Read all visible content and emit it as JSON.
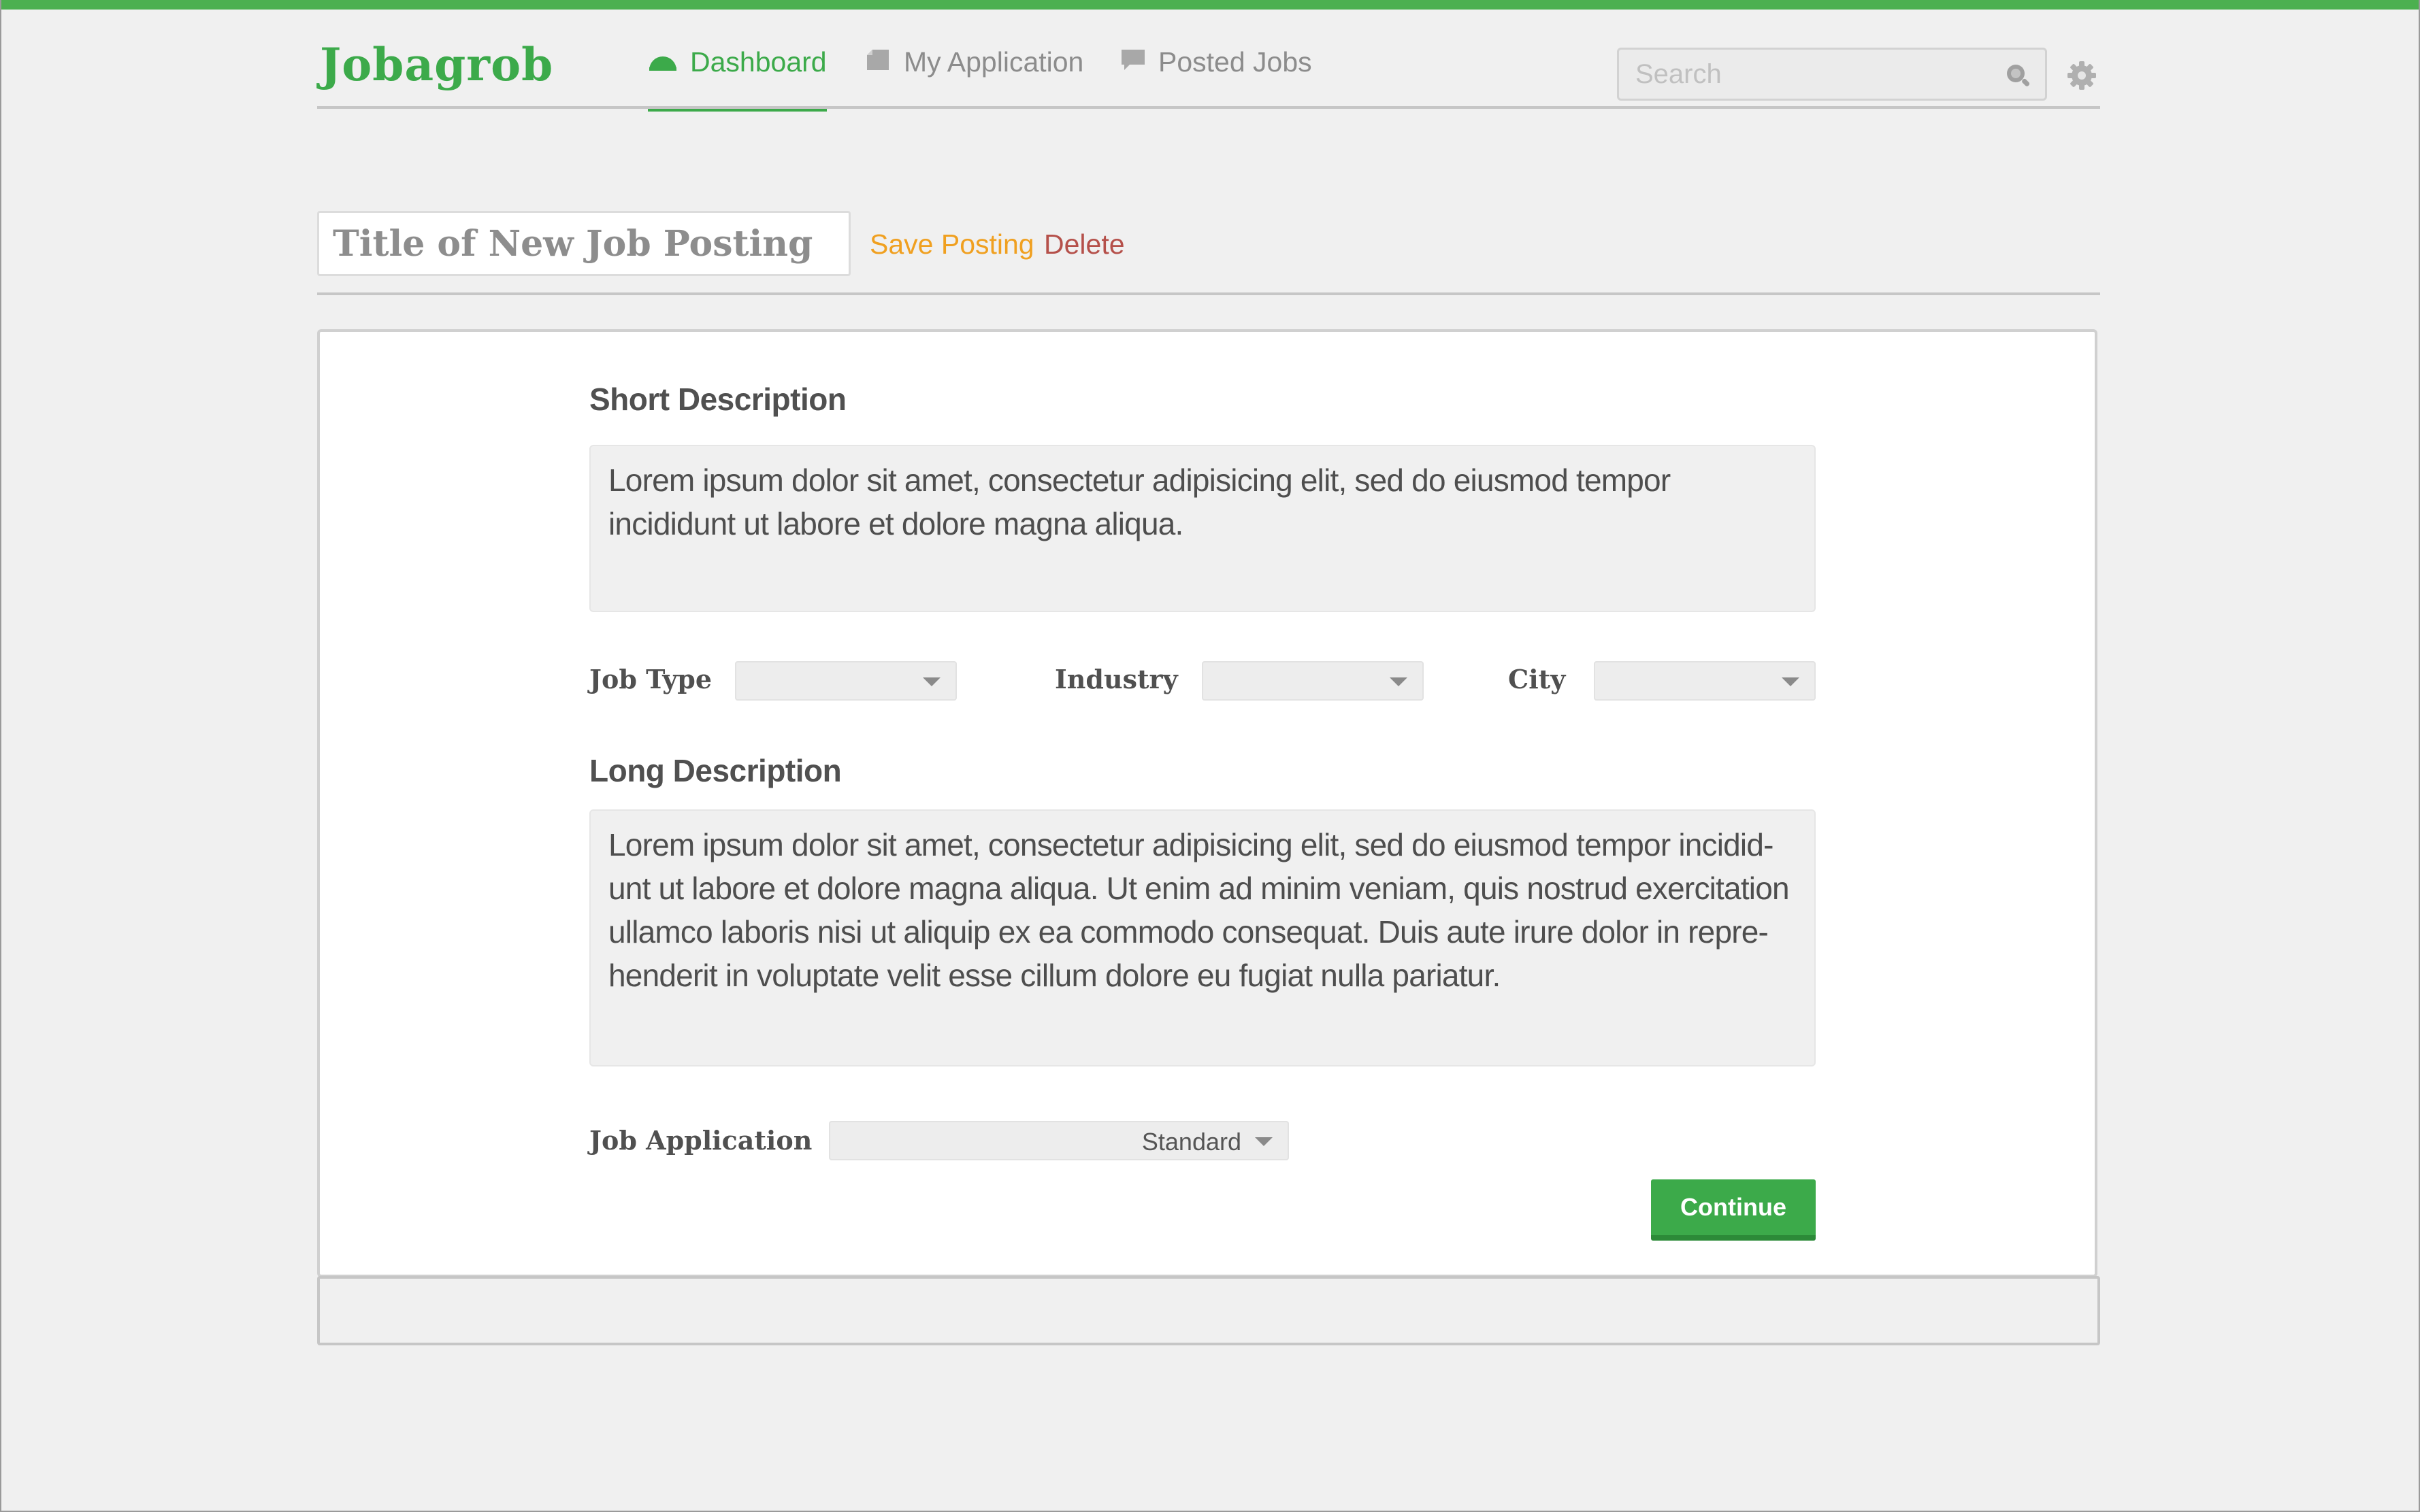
{
  "app": {
    "brand": "Jobagrob",
    "accent_color": "#3caa4a"
  },
  "nav": {
    "items": [
      {
        "label": "Dashboard",
        "icon": "dashboard-icon",
        "active": true
      },
      {
        "label": "My Application",
        "icon": "document-icon",
        "active": false
      },
      {
        "label": "Posted Jobs",
        "icon": "chat-bubble-icon",
        "active": false
      }
    ]
  },
  "search": {
    "placeholder": "Search",
    "value": ""
  },
  "posting": {
    "title_placeholder": "Title of New Job Posting",
    "save_label": "Save Posting",
    "delete_label": "Delete"
  },
  "form": {
    "short_description": {
      "label": "Short Description",
      "text": "Lorem ipsum dolor sit amet, consectetur adipisicing elit, sed do eiusmod tempor incididunt ut labore et dolore magna aliqua."
    },
    "job_type": {
      "label": "Job Type",
      "value": ""
    },
    "industry": {
      "label": "Industry",
      "value": ""
    },
    "city": {
      "label": "City",
      "value": ""
    },
    "long_description": {
      "label": "Long Description",
      "text": "Lorem ipsum dolor sit amet, consectetur adipisicing elit, sed do eiusmod tempor incidid-unt ut labore et dolore magna aliqua. Ut enim ad minim veniam, quis nostrud exercitation ullamco laboris nisi ut aliquip ex ea commodo consequat. Duis aute irure dolor in repre-henderit in voluptate velit esse cillum dolore eu fugiat nulla pariatur."
    },
    "job_application": {
      "label": "Job Application",
      "value": "Standard"
    },
    "continue_label": "Continue"
  }
}
